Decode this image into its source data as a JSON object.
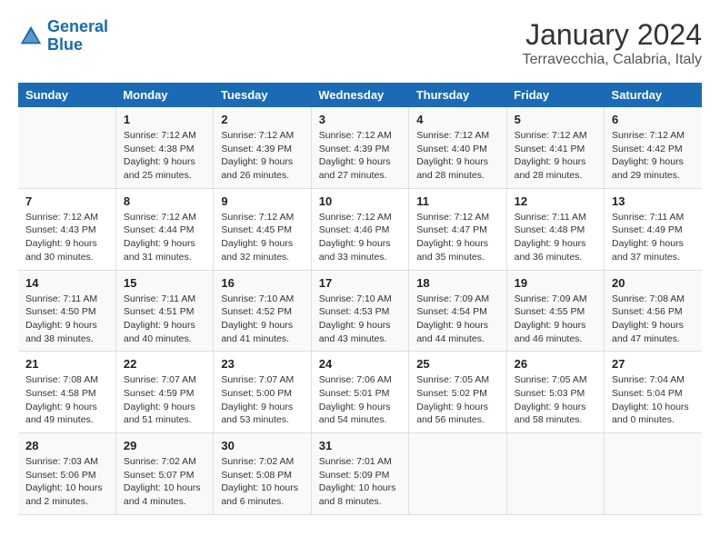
{
  "header": {
    "logo_line1": "General",
    "logo_line2": "Blue",
    "main_title": "January 2024",
    "subtitle": "Terravecchia, Calabria, Italy"
  },
  "calendar": {
    "days_of_week": [
      "Sunday",
      "Monday",
      "Tuesday",
      "Wednesday",
      "Thursday",
      "Friday",
      "Saturday"
    ],
    "weeks": [
      [
        {
          "day": "",
          "info": ""
        },
        {
          "day": "1",
          "info": "Sunrise: 7:12 AM\nSunset: 4:38 PM\nDaylight: 9 hours\nand 25 minutes."
        },
        {
          "day": "2",
          "info": "Sunrise: 7:12 AM\nSunset: 4:39 PM\nDaylight: 9 hours\nand 26 minutes."
        },
        {
          "day": "3",
          "info": "Sunrise: 7:12 AM\nSunset: 4:39 PM\nDaylight: 9 hours\nand 27 minutes."
        },
        {
          "day": "4",
          "info": "Sunrise: 7:12 AM\nSunset: 4:40 PM\nDaylight: 9 hours\nand 28 minutes."
        },
        {
          "day": "5",
          "info": "Sunrise: 7:12 AM\nSunset: 4:41 PM\nDaylight: 9 hours\nand 28 minutes."
        },
        {
          "day": "6",
          "info": "Sunrise: 7:12 AM\nSunset: 4:42 PM\nDaylight: 9 hours\nand 29 minutes."
        }
      ],
      [
        {
          "day": "7",
          "info": "Sunrise: 7:12 AM\nSunset: 4:43 PM\nDaylight: 9 hours\nand 30 minutes."
        },
        {
          "day": "8",
          "info": "Sunrise: 7:12 AM\nSunset: 4:44 PM\nDaylight: 9 hours\nand 31 minutes."
        },
        {
          "day": "9",
          "info": "Sunrise: 7:12 AM\nSunset: 4:45 PM\nDaylight: 9 hours\nand 32 minutes."
        },
        {
          "day": "10",
          "info": "Sunrise: 7:12 AM\nSunset: 4:46 PM\nDaylight: 9 hours\nand 33 minutes."
        },
        {
          "day": "11",
          "info": "Sunrise: 7:12 AM\nSunset: 4:47 PM\nDaylight: 9 hours\nand 35 minutes."
        },
        {
          "day": "12",
          "info": "Sunrise: 7:11 AM\nSunset: 4:48 PM\nDaylight: 9 hours\nand 36 minutes."
        },
        {
          "day": "13",
          "info": "Sunrise: 7:11 AM\nSunset: 4:49 PM\nDaylight: 9 hours\nand 37 minutes."
        }
      ],
      [
        {
          "day": "14",
          "info": "Sunrise: 7:11 AM\nSunset: 4:50 PM\nDaylight: 9 hours\nand 38 minutes."
        },
        {
          "day": "15",
          "info": "Sunrise: 7:11 AM\nSunset: 4:51 PM\nDaylight: 9 hours\nand 40 minutes."
        },
        {
          "day": "16",
          "info": "Sunrise: 7:10 AM\nSunset: 4:52 PM\nDaylight: 9 hours\nand 41 minutes."
        },
        {
          "day": "17",
          "info": "Sunrise: 7:10 AM\nSunset: 4:53 PM\nDaylight: 9 hours\nand 43 minutes."
        },
        {
          "day": "18",
          "info": "Sunrise: 7:09 AM\nSunset: 4:54 PM\nDaylight: 9 hours\nand 44 minutes."
        },
        {
          "day": "19",
          "info": "Sunrise: 7:09 AM\nSunset: 4:55 PM\nDaylight: 9 hours\nand 46 minutes."
        },
        {
          "day": "20",
          "info": "Sunrise: 7:08 AM\nSunset: 4:56 PM\nDaylight: 9 hours\nand 47 minutes."
        }
      ],
      [
        {
          "day": "21",
          "info": "Sunrise: 7:08 AM\nSunset: 4:58 PM\nDaylight: 9 hours\nand 49 minutes."
        },
        {
          "day": "22",
          "info": "Sunrise: 7:07 AM\nSunset: 4:59 PM\nDaylight: 9 hours\nand 51 minutes."
        },
        {
          "day": "23",
          "info": "Sunrise: 7:07 AM\nSunset: 5:00 PM\nDaylight: 9 hours\nand 53 minutes."
        },
        {
          "day": "24",
          "info": "Sunrise: 7:06 AM\nSunset: 5:01 PM\nDaylight: 9 hours\nand 54 minutes."
        },
        {
          "day": "25",
          "info": "Sunrise: 7:05 AM\nSunset: 5:02 PM\nDaylight: 9 hours\nand 56 minutes."
        },
        {
          "day": "26",
          "info": "Sunrise: 7:05 AM\nSunset: 5:03 PM\nDaylight: 9 hours\nand 58 minutes."
        },
        {
          "day": "27",
          "info": "Sunrise: 7:04 AM\nSunset: 5:04 PM\nDaylight: 10 hours\nand 0 minutes."
        }
      ],
      [
        {
          "day": "28",
          "info": "Sunrise: 7:03 AM\nSunset: 5:06 PM\nDaylight: 10 hours\nand 2 minutes."
        },
        {
          "day": "29",
          "info": "Sunrise: 7:02 AM\nSunset: 5:07 PM\nDaylight: 10 hours\nand 4 minutes."
        },
        {
          "day": "30",
          "info": "Sunrise: 7:02 AM\nSunset: 5:08 PM\nDaylight: 10 hours\nand 6 minutes."
        },
        {
          "day": "31",
          "info": "Sunrise: 7:01 AM\nSunset: 5:09 PM\nDaylight: 10 hours\nand 8 minutes."
        },
        {
          "day": "",
          "info": ""
        },
        {
          "day": "",
          "info": ""
        },
        {
          "day": "",
          "info": ""
        }
      ]
    ]
  }
}
